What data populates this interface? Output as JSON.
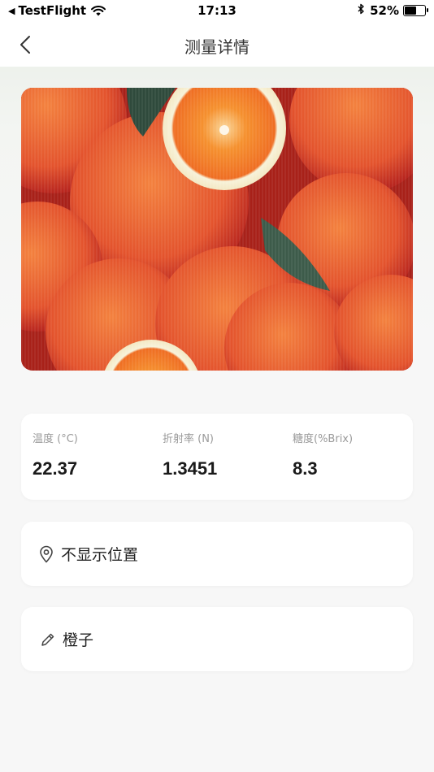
{
  "status_bar": {
    "back_app": "TestFlight",
    "time": "17:13",
    "battery_percent": "52%",
    "battery_level": 0.52
  },
  "nav": {
    "title": "测量详情"
  },
  "photo": {
    "subject": "oranges",
    "page_count": 1,
    "current_page": 1
  },
  "measurements": [
    {
      "label": "温度 (°C)",
      "value": "22.37"
    },
    {
      "label": "折射率 (N)",
      "value": "1.3451"
    },
    {
      "label": "糖度(%Brix)",
      "value": "8.3"
    }
  ],
  "location": {
    "icon": "location-pin-icon",
    "text": "不显示位置"
  },
  "note": {
    "icon": "pencil-icon",
    "text": "橙子"
  },
  "colors": {
    "accent_text": "#1a1a1a",
    "label_gray": "#9a9a9a",
    "page_bg": "#f7f7f7"
  }
}
